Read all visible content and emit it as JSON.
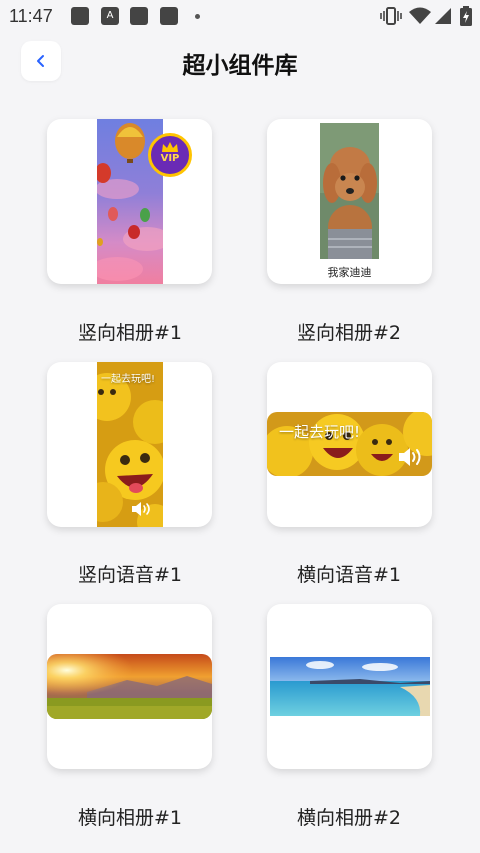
{
  "status_bar": {
    "time": "11:47",
    "notification_a": "A"
  },
  "header": {
    "title": "超小组件库"
  },
  "widgets": [
    {
      "caption": "竖向相册#1",
      "badge": "VIP"
    },
    {
      "caption": "竖向相册#2",
      "photo_label": "我家迪迪"
    },
    {
      "caption": "竖向语音#1",
      "overlay_text": "一起去玩吧!"
    },
    {
      "caption": "横向语音#1",
      "overlay_text": "一起去玩吧!"
    },
    {
      "caption": "横向相册#1"
    },
    {
      "caption": "横向相册#2"
    }
  ],
  "colors": {
    "background": "#f5f5f7",
    "card": "#ffffff",
    "back_arrow": "#2962ff"
  }
}
